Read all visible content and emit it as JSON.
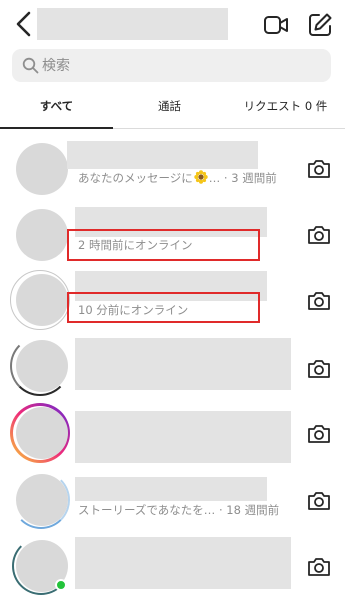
{
  "search": {
    "placeholder": "検索"
  },
  "tabs": [
    {
      "label": "すべて",
      "active": true
    },
    {
      "label": "通話",
      "active": false
    },
    {
      "label": "リクエスト 0 件",
      "active": false
    }
  ],
  "threads": [
    {
      "text": "あなたのメッセージに",
      "suffix": "… · 3 週間前",
      "reaction": "sunflower-icon"
    },
    {
      "text": "2 時間前にオンライン"
    },
    {
      "text": "10 分前にオンライン"
    },
    {
      "text": ""
    },
    {
      "text": ""
    },
    {
      "text": "ストーリーズであなたを… · 18 週間前"
    },
    {
      "text": ""
    }
  ],
  "colors": {
    "highlight": "#e02a2a",
    "online": "#23c33b",
    "text": "#262626",
    "muted": "#8e8e8e"
  }
}
